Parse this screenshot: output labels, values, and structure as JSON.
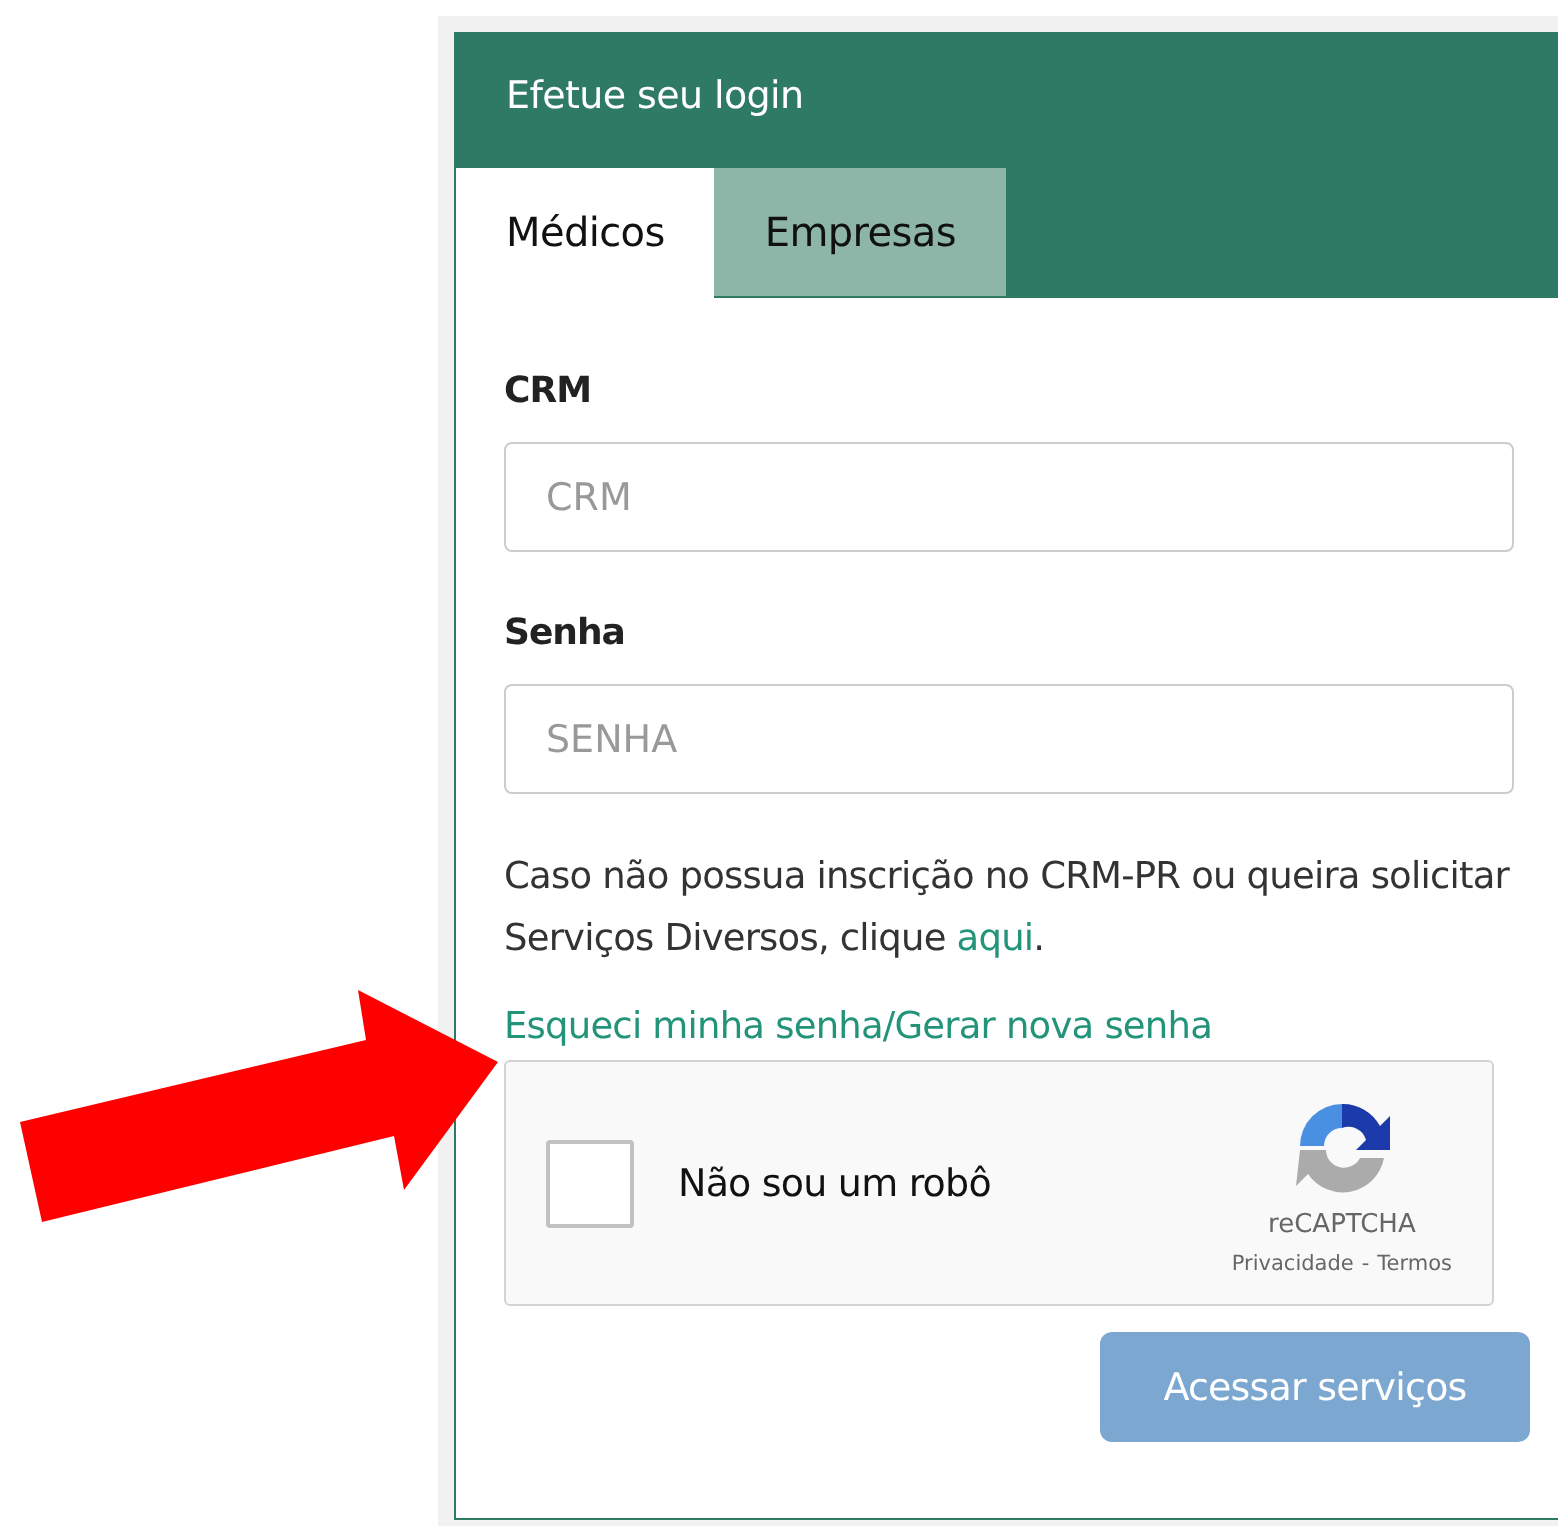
{
  "panel": {
    "title": "Efetue seu login"
  },
  "tabs": [
    {
      "label": "Médicos",
      "selected": true
    },
    {
      "label": "Empresas",
      "selected": false
    }
  ],
  "fields": [
    {
      "label": "CRM",
      "placeholder": "CRM"
    },
    {
      "label": "Senha",
      "placeholder": "SENHA"
    }
  ],
  "notice": {
    "text": "Caso não possua inscrição no CRM-PR ou queira solicitar Serviços Diversos, clique ",
    "link": "aqui",
    "after": "."
  },
  "forgot_link": "Esqueci minha senha/Gerar nova senha",
  "captcha": {
    "label": "Não sou um robô",
    "checked": false,
    "brand": "reCAPTCHA",
    "privacy": "Privacidade",
    "separator": "-",
    "terms": "Termos"
  },
  "submit": {
    "label": "Acessar serviços",
    "disabled": true
  }
}
